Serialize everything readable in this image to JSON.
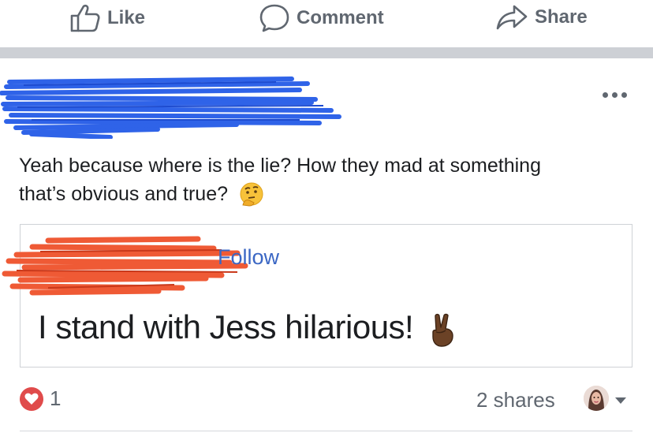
{
  "actions": {
    "like_label": "Like",
    "comment_label": "Comment",
    "share_label": "Share"
  },
  "post": {
    "text": "Yeah because where is the lie? How they mad at something that’s obvious and true?",
    "emoji": "thinking-face",
    "shared": {
      "follow_label": "Follow",
      "text": "I stand with Jess hilarious!",
      "emoji": "victory-hand"
    },
    "reactions": {
      "type": "love",
      "count": "1"
    },
    "shares": "2 shares"
  },
  "colors": {
    "action_gray": "#606770",
    "follow_blue": "#3b67c4",
    "love_red": "#e04b4b",
    "redact_blue": "#2f63e8",
    "redact_red": "#ef5a35"
  }
}
